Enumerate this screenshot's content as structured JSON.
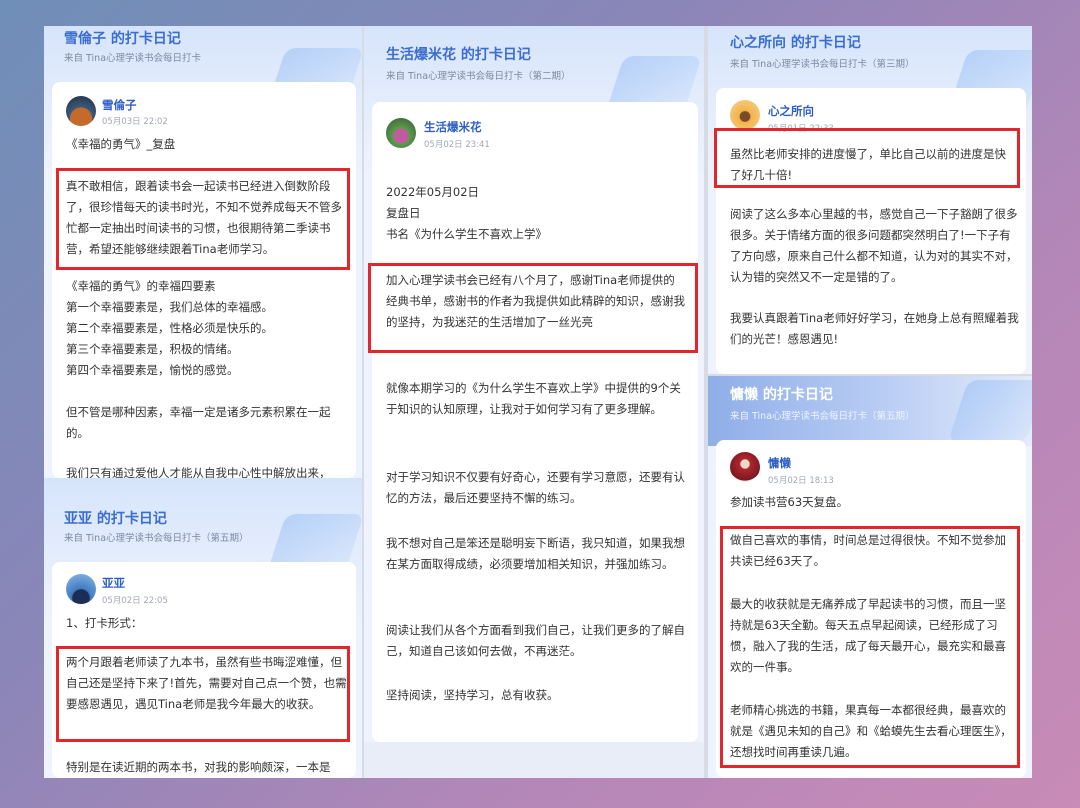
{
  "panels": {
    "p1": {
      "title": "雪倫子 的打卡日记",
      "subtitle": "来自 Tina心理学读书会每日打卡",
      "user": "雪倫子",
      "date": "05月03日 22:02",
      "book": "《幸福的勇气》_复盘",
      "highlight": "真不敢相信，跟着读书会一起读书已经进入倒数阶段了，很珍惜每天的读书时光，不知不觉养成每天不管多忙都一定抽出时间读书的习惯，也很期待第二季读书营，希望还能够继续跟着Tina老师学习。",
      "section_title": "《幸福的勇气》的幸福四要素",
      "items": [
        "第一个幸福要素是，我们总体的幸福感。",
        "第二个幸福要素是，性格必须是快乐的。",
        "第三个幸福要素是，积极的情绪。",
        "第四个幸福要素是，愉悦的感觉。"
      ],
      "para1": "但不管是哪种因素，幸福一定是诸多元素积累在一起的。",
      "para2": "我们只有通过爱他人才能从自我中心性中解放出来，"
    },
    "p2": {
      "title": "亚亚 的打卡日记",
      "subtitle": "来自 Tina心理学读书会每日打卡（第五期）",
      "user": "亚亚",
      "date": "05月02日 22:05",
      "intro": "1、打卡形式：",
      "highlight": "两个月跟着老师读了九本书，虽然有些书晦涩难懂，但自己还是坚持下来了!首先，需要对自己点一个赞，也需要感恩遇见，遇见Tina老师是我今年最大的收获。",
      "tail": "特别是在读近期的两本书，对我的影响颇深，一本是"
    },
    "p3": {
      "title": "生活爆米花 的打卡日记",
      "subtitle": "来自 Tina心理学读书会每日打卡（第二期）",
      "user": "生活爆米花",
      "date": "05月02日 23:41",
      "line1": "2022年05月02日",
      "line2": "复盘日",
      "line3": "书名《为什么学生不喜欢上学》",
      "highlight": "加入心理学读书会已经有八个月了，感谢Tina老师提供的经典书单，感谢书的作者为我提供如此精辟的知识，感谢我的坚持，为我迷茫的生活增加了一丝光亮",
      "para1": "就像本期学习的《为什么学生不喜欢上学》中提供的9个关于知识的认知原理，让我对于如何学习有了更多理解。",
      "para2": "对于学习知识不仅要有好奇心，还要有学习意愿，还要有认忆的方法，最后还要坚持不懈的练习。",
      "para3": "我不想对自己是笨还是聪明妄下断语，我只知道，如果我想在某方面取得成绩，必须要增加相关知识，并强加练习。",
      "para4": "阅读让我们从各个方面看到我们自己，让我们更多的了解自己，知道自己该如何去做，不再迷茫。",
      "para5": "坚持阅读，坚持学习，总有收获。"
    },
    "p4": {
      "title": "心之所向 的打卡日记",
      "subtitle": "来自 Tina心理学读书会每日打卡（第三期）",
      "user": "心之所向",
      "date": "05月01日 22:33",
      "highlight": "虽然比老师安排的进度慢了，单比自己以前的进度是快了好几十倍!",
      "para1": "阅读了这么多本心里越的书，感觉自己一下子豁朗了很多很多。关于情绪方面的很多问题都突然明白了!一下子有了方向感，原来自己什么都不知道，认为对的其实不对，认为错的突然又不一定是错的了。",
      "para2": "我要认真跟着Tina老师好好学习，在她身上总有照耀着我们的光芒！感恩遇见!"
    },
    "p5": {
      "title": "慵懒  的打卡日记",
      "subtitle": "来自 Tina心理学读书会每日打卡（第五期）",
      "user": "慵懒",
      "date": "05月02日 18:13",
      "intro": "参加读书营63天复盘。",
      "hl1": "做自己喜欢的事情，时间总是过得很快。不知不觉参加共读已经63天了。",
      "hl2": "最大的收获就是无痛养成了早起读书的习惯，而且一坚持就是63天全勤。每天五点早起阅读，已经形成了习惯，融入了我的生活，成了每天最开心，最充实和最喜欢的一件事。",
      "hl3": "老师精心挑选的书籍，果真每一本都很经典，最喜欢的就是《遇见未知的自己》和《蛤蟆先生去看心理医生》，还想找时间再重读几遍。"
    }
  },
  "colors": {
    "accent_blue": "#3a6ed0",
    "highlight_red": "#e1262c"
  }
}
